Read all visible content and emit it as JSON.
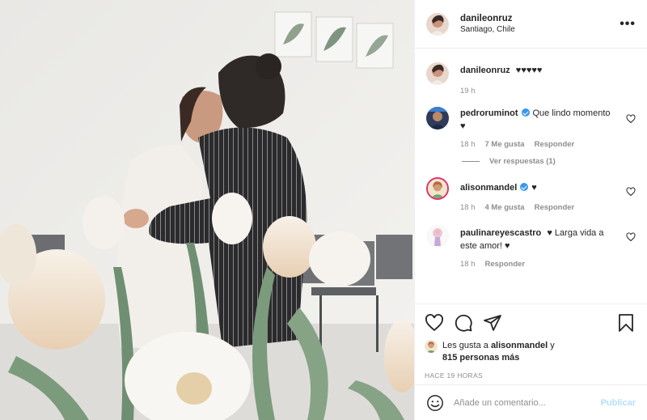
{
  "post": {
    "username": "danileonruz",
    "location": "Santiago, Chile",
    "more_label": "•••"
  },
  "caption": {
    "username": "danileonruz",
    "text": "♥♥♥♥♥",
    "time": "19 h"
  },
  "comments": [
    {
      "username": "pedroruminot",
      "verified": true,
      "text": "Que lindo momento ♥",
      "time": "18 h",
      "likes": "7 Me gusta",
      "reply": "Responder",
      "view_replies": "Ver respuestas (1)"
    },
    {
      "username": "alisonmandel",
      "verified": true,
      "text": "♥",
      "time": "18 h",
      "likes": "4 Me gusta",
      "reply": "Responder"
    },
    {
      "username": "paulinareyescastro",
      "verified": false,
      "text": "♥ Larga vida a este amor! ♥",
      "time": "18 h",
      "reply": "Responder"
    }
  ],
  "likes_line": {
    "prefix": "Les gusta a",
    "user": "alisonmandel",
    "joiner": "y",
    "others": "815 personas más"
  },
  "posted_time": "HACE 19 HORAS",
  "add_comment": {
    "placeholder": "Añade un comentario...",
    "publish_label": "Publicar"
  },
  "icons": [
    "heart-icon",
    "comment-icon",
    "share-icon",
    "bookmark-icon",
    "emoji-icon",
    "more-icon",
    "verified-icon"
  ],
  "colors": {
    "link_blue": "#3897f0",
    "publish_disabled": "#b2dffc",
    "muted": "#8e8e8e",
    "text": "#262626"
  }
}
